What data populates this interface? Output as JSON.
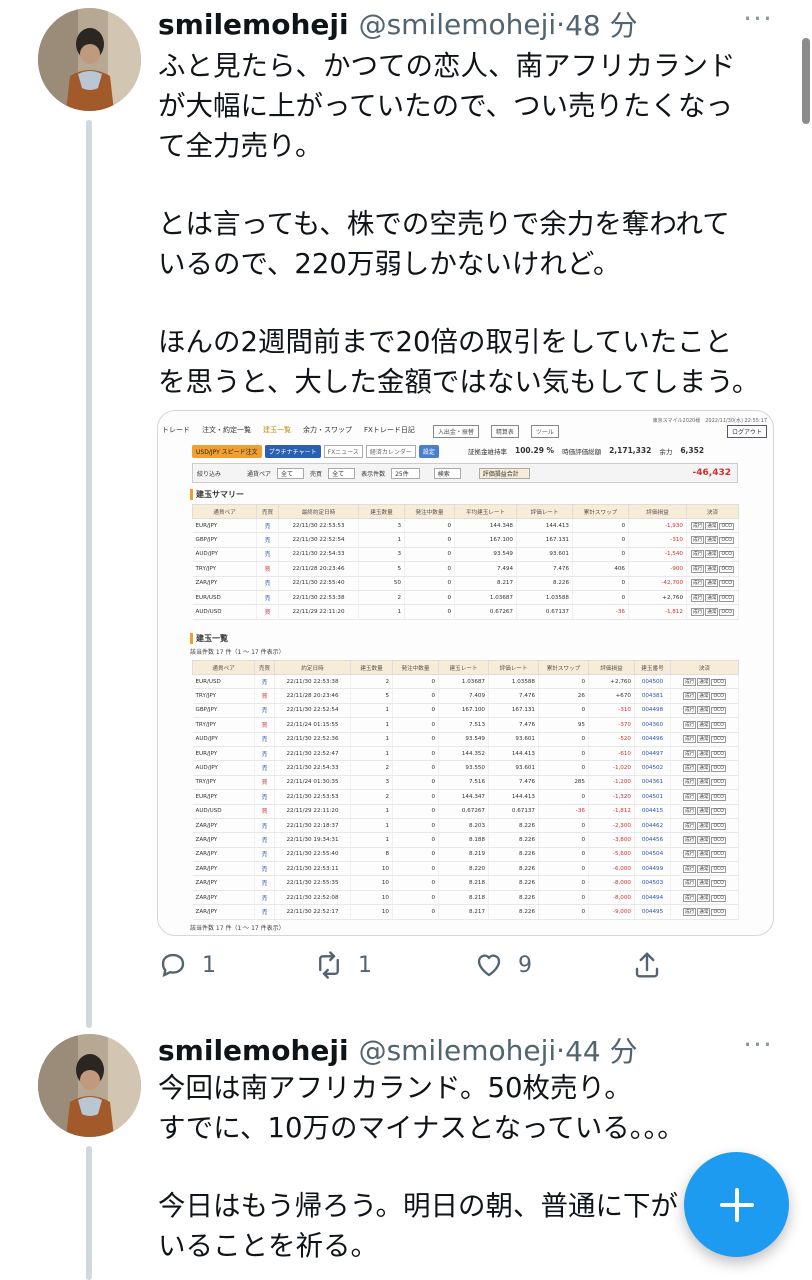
{
  "tweets": [
    {
      "name": "smilemoheji",
      "handle": "@smilemoheji",
      "time": "48 分",
      "lines": [
        "ふと見たら、かつての恋人、南アフリカランド",
        "が大幅に上がっていたので、つい売りたくなっ",
        "て全力売り。",
        "",
        "とは言っても、株での空売りで余力を奪われて",
        "いるので、220万弱しかないけれど。",
        "",
        "ほんの2週間前まで20倍の取引をしていたこと",
        "を思うと、大した金額ではない気もしてしまう。"
      ],
      "reply_count": "1",
      "retweet_count": "1",
      "like_count": "9"
    },
    {
      "name": "smilemoheji",
      "handle": "@smilemoheji",
      "time": "44 分",
      "lines": [
        "今回は南アフリカランド。50枚売り。",
        "すでに、10万のマイナスとなっている。。。",
        "",
        "今日はもう帰ろう。明日の朝、普通に下が",
        "いることを祈る。"
      ]
    }
  ],
  "screenshot": {
    "nav": [
      "トレード",
      "注文・約定一覧",
      "建玉一覧",
      "余力・スワップ",
      "FXトレード日記"
    ],
    "nav_buttons": [
      "入出金・振替",
      "精算表",
      "ツール"
    ],
    "top_right": "東京スマイル2020様　2022/11/30(水) 22:55:17",
    "logout": "ログアウト",
    "toolbar": {
      "pair_button": "USD/JPY スピード注文",
      "chart_button": "プラチナチャート",
      "news_button": "FXニュース",
      "calendar_button": "経済カレンダー",
      "settings_button": "設定"
    },
    "metrics": {
      "margin_label": "証拠金維持率",
      "margin_value": "100.29 %",
      "valuation_label": "時価評価総額",
      "valuation_value": "2,171,332",
      "surplus_label": "余力",
      "surplus_value": "6,352"
    },
    "filter": {
      "label": "絞り込み",
      "pair_label": "通貨ペア",
      "pair_value": "全て",
      "side_label": "売買",
      "side_value": "全て",
      "count_label": "表示件数",
      "count_value": "25件",
      "search": "検索",
      "pl_label": "評価損益合計",
      "pl_value": "-46,432"
    },
    "summary_title": "建玉サマリー",
    "summary_headers": [
      "通貨ペア",
      "売買",
      "最終約定日時",
      "建玉数量",
      "発注中数量",
      "平均建玉レート",
      "評価レート",
      "累計スワップ",
      "評価損益",
      "決済"
    ],
    "summary_rows": [
      [
        "EUR/JPY",
        "売",
        "22/11/30 22:53:53",
        "3",
        "0",
        "144.348",
        "144.413",
        "0",
        "-1,930"
      ],
      [
        "GBP/JPY",
        "売",
        "22/11/30 22:52:54",
        "1",
        "0",
        "167.100",
        "167.131",
        "0",
        "-310"
      ],
      [
        "AUD/JPY",
        "売",
        "22/11/30 22:54:33",
        "3",
        "0",
        "93.549",
        "93.601",
        "0",
        "-1,540"
      ],
      [
        "TRY/JPY",
        "買",
        "22/11/28 20:23:46",
        "5",
        "0",
        "7.494",
        "7.476",
        "406",
        "-900"
      ],
      [
        "ZAR/JPY",
        "売",
        "22/11/30 22:55:40",
        "50",
        "0",
        "8.217",
        "8.226",
        "0",
        "-42,700"
      ],
      [
        "EUR/USD",
        "売",
        "22/11/30 22:53:38",
        "2",
        "0",
        "1.03687",
        "1.03588",
        "0",
        "+2,760"
      ],
      [
        "AUD/USD",
        "買",
        "22/11/29 22:11:20",
        "1",
        "0",
        "0.67267",
        "0.67137",
        "-36",
        "-1,812"
      ]
    ],
    "list_title": "建玉一覧",
    "list_count_top": "該当件数 17 件（1 〜 17 件表示）",
    "list_count_bottom": "該当件数 17 件（1 〜 17 件表示）",
    "list_headers": [
      "通貨ペア",
      "売買",
      "約定日時",
      "建玉数量",
      "発注中数量",
      "建玉レート",
      "評価レート",
      "累計スワップ",
      "評価損益",
      "建玉番号",
      "決済"
    ],
    "list_rows": [
      [
        "EUR/USD",
        "売",
        "22/11/30 22:53:38",
        "2",
        "0",
        "1.03687",
        "1.03588",
        "0",
        "+2,760",
        "004500"
      ],
      [
        "TRY/JPY",
        "買",
        "22/11/28 20:23:46",
        "5",
        "0",
        "7.409",
        "7.476",
        "26",
        "+670",
        "004381"
      ],
      [
        "GBP/JPY",
        "売",
        "22/11/30 22:52:54",
        "1",
        "0",
        "167.100",
        "167.131",
        "0",
        "-310",
        "004498"
      ],
      [
        "TRY/JPY",
        "買",
        "22/11/24 01:15:55",
        "1",
        "0",
        "7.513",
        "7.476",
        "95",
        "-370",
        "004360"
      ],
      [
        "AUD/JPY",
        "売",
        "22/11/30 22:52:36",
        "1",
        "0",
        "93.549",
        "93.601",
        "0",
        "-520",
        "004496"
      ],
      [
        "EUR/JPY",
        "売",
        "22/11/30 22:52:47",
        "1",
        "0",
        "144.352",
        "144.413",
        "0",
        "-610",
        "004497"
      ],
      [
        "AUD/JPY",
        "売",
        "22/11/30 22:54:33",
        "2",
        "0",
        "93.550",
        "93.601",
        "0",
        "-1,020",
        "004502"
      ],
      [
        "TRY/JPY",
        "買",
        "22/11/24 01:30:35",
        "3",
        "0",
        "7.516",
        "7.476",
        "285",
        "-1,200",
        "004361"
      ],
      [
        "EUR/JPY",
        "売",
        "22/11/30 22:53:53",
        "2",
        "0",
        "144.347",
        "144.413",
        "0",
        "-1,320",
        "004501"
      ],
      [
        "AUD/USD",
        "買",
        "22/11/29 22:11:20",
        "1",
        "0",
        "0.67267",
        "0.67137",
        "-36",
        "-1,812",
        "004415"
      ],
      [
        "ZAR/JPY",
        "売",
        "22/11/30 22:18:37",
        "1",
        "0",
        "8.203",
        "8.226",
        "0",
        "-2,300",
        "004462"
      ],
      [
        "ZAR/JPY",
        "売",
        "22/11/30 19:34:31",
        "1",
        "0",
        "8.188",
        "8.226",
        "0",
        "-3,800",
        "004456"
      ],
      [
        "ZAR/JPY",
        "売",
        "22/11/30 22:55:40",
        "8",
        "0",
        "8.219",
        "8.226",
        "0",
        "-5,600",
        "004504"
      ],
      [
        "ZAR/JPY",
        "売",
        "22/11/30 22:53:11",
        "10",
        "0",
        "8.220",
        "8.226",
        "0",
        "-6,000",
        "004499"
      ],
      [
        "ZAR/JPY",
        "売",
        "22/11/30 22:55:35",
        "10",
        "0",
        "8.218",
        "8.226",
        "0",
        "-8,000",
        "004503"
      ],
      [
        "ZAR/JPY",
        "売",
        "22/11/30 22:52:08",
        "10",
        "0",
        "8.218",
        "8.226",
        "0",
        "-8,000",
        "004494"
      ],
      [
        "ZAR/JPY",
        "売",
        "22/11/30 22:52:17",
        "10",
        "0",
        "8.217",
        "8.226",
        "0",
        "-9,000",
        "004495"
      ]
    ],
    "settle_buttons": [
      "成行",
      "通常",
      "OCO"
    ]
  },
  "icons": {
    "reply": "reply-icon",
    "retweet": "retweet-icon",
    "like": "heart-icon",
    "share": "share-icon",
    "compose": "plus-icon"
  },
  "colors": {
    "accent": "#1d9bf0",
    "text": "#0f1419",
    "muted": "#536471",
    "loss": "#d03030"
  }
}
